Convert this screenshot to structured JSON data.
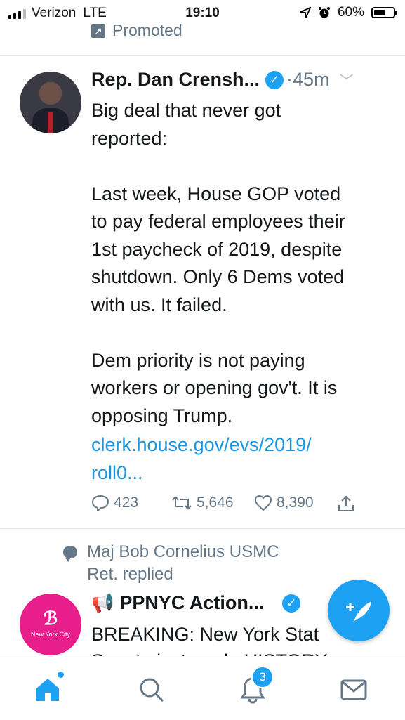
{
  "status_bar": {
    "carrier": "Verizon",
    "network": "LTE",
    "time": "19:10",
    "battery": "60%",
    "battery_level": 0.6
  },
  "promoted_label": "Promoted",
  "tweet": {
    "author": "Rep. Dan Crensh...",
    "time": "·45m",
    "text": "Big deal that never got\nreported:\n\nLast week, House GOP voted\nto pay federal employees their\n1st paycheck of 2019, despite\nshutdown. Only 6 Dems voted\nwith us. It failed.\n\nDem priority is not paying\nworkers or opening gov't. It is\nopposing Trump.",
    "link": "clerk.house.gov/evs/2019/\nroll0...",
    "replies": "423",
    "retweets": "5,646",
    "likes": "8,390"
  },
  "reply_context": "Maj Bob Cornelius USMC\nRet. replied",
  "tweet2": {
    "author": "PPNYC Action...",
    "avatar_text": "New York City",
    "text": "BREAKING: New York Stat\nSenate just made HISTORY"
  },
  "tabbar": {
    "notifications_badge": "3"
  },
  "colors": {
    "accent": "#1da1f2",
    "secondary_text": "#657786",
    "ppnyc_pink": "#e81e8c"
  }
}
